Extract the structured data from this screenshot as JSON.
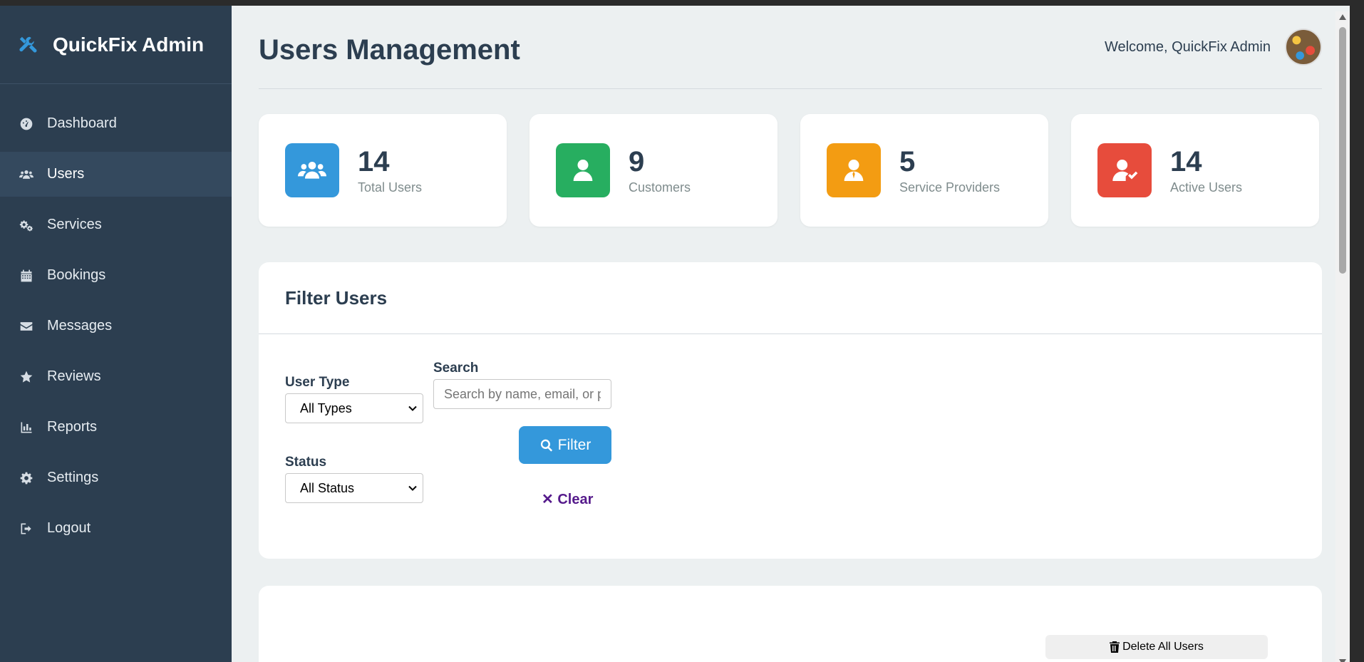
{
  "sidebar": {
    "title": "QuickFix Admin",
    "items": [
      {
        "label": "Dashboard",
        "icon": "dashboard-icon"
      },
      {
        "label": "Users",
        "icon": "users-icon",
        "active": true
      },
      {
        "label": "Services",
        "icon": "cogs-icon"
      },
      {
        "label": "Bookings",
        "icon": "calendar-icon"
      },
      {
        "label": "Messages",
        "icon": "envelope-icon"
      },
      {
        "label": "Reviews",
        "icon": "star-icon"
      },
      {
        "label": "Reports",
        "icon": "chart-icon"
      },
      {
        "label": "Settings",
        "icon": "gear-icon"
      },
      {
        "label": "Logout",
        "icon": "logout-icon"
      }
    ]
  },
  "header": {
    "title": "Users Management",
    "welcome": "Welcome, QuickFix Admin"
  },
  "stats": [
    {
      "value": "14",
      "label": "Total Users",
      "color": "#3498db"
    },
    {
      "value": "9",
      "label": "Customers",
      "color": "#27ae60"
    },
    {
      "value": "5",
      "label": "Service Providers",
      "color": "#f39c12"
    },
    {
      "value": "14",
      "label": "Active Users",
      "color": "#e74c3c"
    }
  ],
  "filter": {
    "title": "Filter Users",
    "user_type_label": "User Type",
    "user_type_value": "All Types",
    "search_label": "Search",
    "search_placeholder": "Search by name, email, or p",
    "status_label": "Status",
    "status_value": "All Status",
    "filter_button": "Filter",
    "clear_link": "Clear"
  },
  "table": {
    "delete_all_button": "Delete All Users"
  }
}
